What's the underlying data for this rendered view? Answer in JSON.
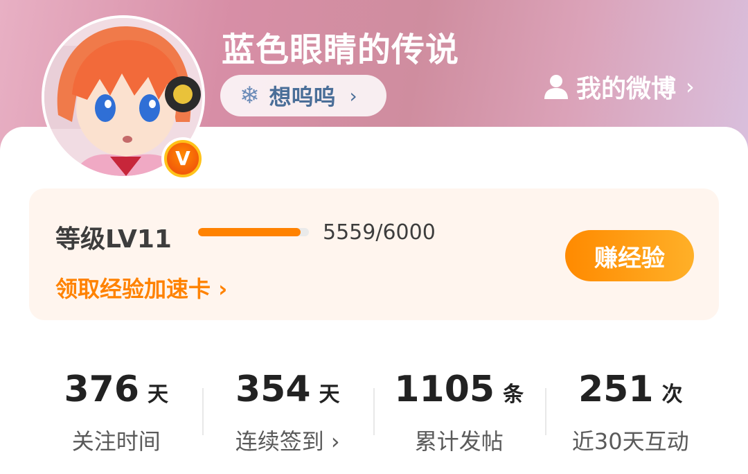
{
  "profile": {
    "username": "蓝色眼睛的传说",
    "status_text": "想呜呜",
    "status_chevron": "›",
    "my_weibo_label": "我的微博",
    "my_weibo_chevron": "›",
    "badge_letter": "V",
    "icons": {
      "status": "snowflake-icon",
      "my_weibo": "person-icon",
      "verified": "verified-v-badge-icon"
    }
  },
  "level": {
    "label": "等级LV11",
    "current": 5559,
    "max": 6000,
    "progress_text": "5559/6000",
    "accel_link": "领取经验加速卡 ›",
    "earn_button": "赚经验"
  },
  "stats": [
    {
      "value": "376",
      "unit": "天",
      "label": "关注时间"
    },
    {
      "value": "354",
      "unit": "天",
      "label": "连续签到 ›"
    },
    {
      "value": "1105",
      "unit": "条",
      "label": "累计发帖"
    },
    {
      "value": "251",
      "unit": "次",
      "label": "近30天互动"
    }
  ],
  "colors": {
    "accent_orange": "#ff8200",
    "status_blue": "#4a6e98",
    "header_pink": "#d78ea6"
  }
}
